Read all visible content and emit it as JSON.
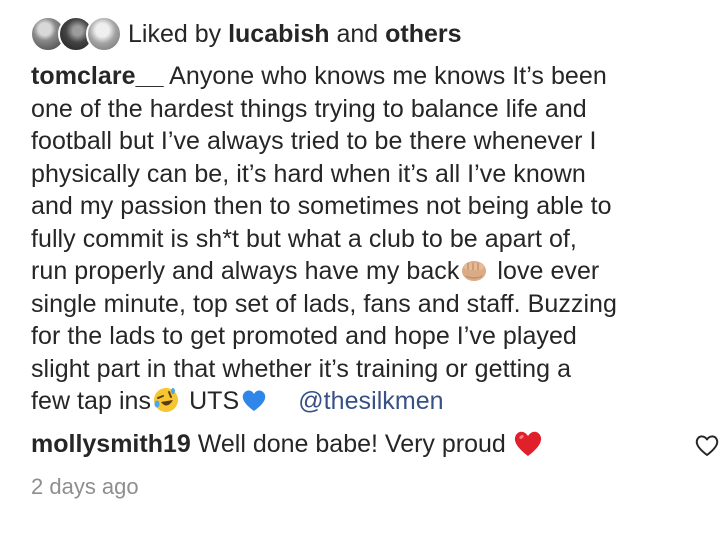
{
  "likes": {
    "prefix": "Liked by",
    "user": "lucabish",
    "and": "and",
    "others": "others"
  },
  "caption": {
    "username": "tomclare__",
    "lines": [
      "Anyone who knows me knows It’s been",
      "one of the hardest things trying to balance life and",
      "football but I’ve always tried to be there whenever I",
      "physically can be, it’s hard when it’s all I’ve known",
      "and my passion then to sometimes not being able to",
      "fully commit is sh*t but what a club to be apart of,",
      "run properly and always have my back",
      "love ever",
      "single minute, top set of lads, fans and staff. Buzzing",
      "for the lads to get promoted and hope I’ve played",
      "slight part in that whether it’s training or getting a",
      "few tap ins",
      "UTS",
      "@thesilkmen"
    ],
    "emojis": {
      "fist": "fist-bump-emoji",
      "laugh": "rolling-on-floor-laughing-emoji",
      "blue_heart": "blue-heart-emoji"
    }
  },
  "comment": {
    "username": "mollysmith19",
    "text": "Well done babe! Very proud",
    "emoji": "red-heart-emoji",
    "like_icon": "heart-outline-icon"
  },
  "timestamp": "2 days ago",
  "colors": {
    "text": "#262626",
    "mention": "#385185",
    "muted": "#8e8e8e",
    "red_heart": "#e0202a",
    "blue_heart": "#2e86e8"
  }
}
